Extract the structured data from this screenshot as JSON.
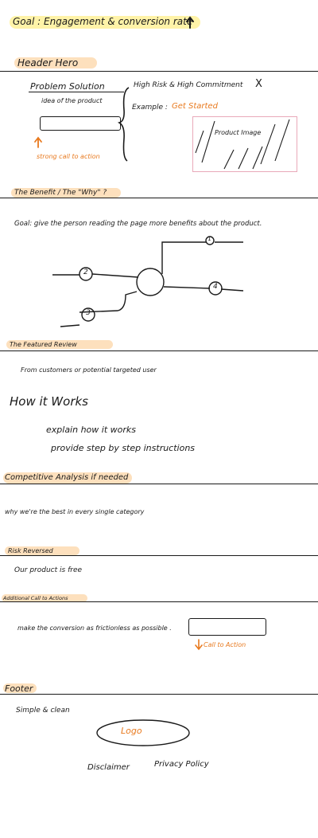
{
  "goal": {
    "text": "Goal : Engagement & conversion rate",
    "arrow": "up-arrow-icon",
    "highlight": "#fff3a8"
  },
  "header_hero": {
    "title": "Header Hero",
    "problem_solution": "Problem Solution",
    "idea": "idea of the product",
    "risk": "High Risk & High Commitment",
    "risk_mark": "X",
    "example_label": "Example :",
    "example_cta": "Get Started",
    "product_image": "Product Image",
    "cta_note": "strong call to action"
  },
  "benefit": {
    "title": "The Benefit / The \"Why\" ?",
    "goal": "Goal: give the person reading the page more benefits about the product.",
    "nodes": [
      "1",
      "2",
      "3",
      "4"
    ]
  },
  "featured_review": {
    "title": "The Featured Review",
    "text": "From customers or potential targeted user"
  },
  "how_it_works": {
    "title": "How it Works",
    "lines": [
      "explain how it works",
      "provide step by step instructions"
    ]
  },
  "competitive": {
    "title": "Competitive Analysis if needed",
    "text": "why we're the best in every single category"
  },
  "risk_reversed": {
    "title": "Risk Reversed",
    "text": "Our product is free"
  },
  "additional_cta": {
    "title": "Additional Call to Actions",
    "text": "make the conversion as frictionless as possible .",
    "cta_note": "Call to Action"
  },
  "footer": {
    "title": "Footer",
    "text": "Simple & clean",
    "logo": "Logo",
    "links": [
      "Disclaimer",
      "Privacy Policy"
    ]
  },
  "colors": {
    "accent": "#e8791e",
    "highlight_orange": "#fde0bd",
    "highlight_yellow": "#fff3a8",
    "image_border": "#e9a9b9",
    "ink": "#1a1a1a"
  }
}
